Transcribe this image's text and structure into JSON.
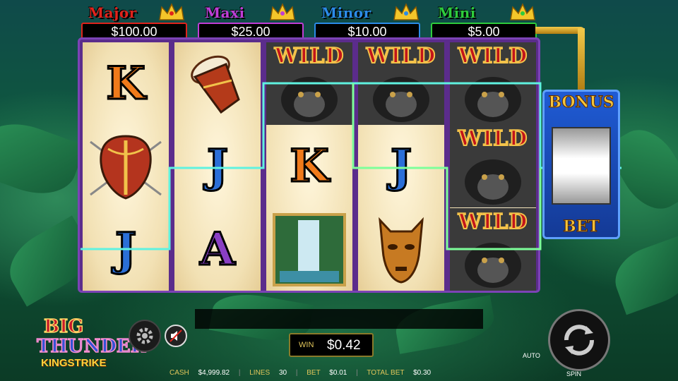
{
  "jackpots": [
    {
      "name": "Major",
      "value": "$100.00",
      "color": "#e0231c"
    },
    {
      "name": "Maxi",
      "value": "$25.00",
      "color": "#c03dd6"
    },
    {
      "name": "Minor",
      "value": "$10.00",
      "color": "#2b8be8"
    },
    {
      "name": "Mini",
      "value": "$5.00",
      "color": "#2ecc3c"
    }
  ],
  "reels": {
    "wild_label": "WILD",
    "symbols": {
      "r1": [
        "K",
        "shield",
        "J"
      ],
      "r2": [
        "drum",
        "J",
        "A"
      ],
      "r3": [
        "WILD",
        "K",
        "waterfall"
      ],
      "r4": [
        "WILD",
        "J",
        "mask"
      ],
      "r5": [
        "WILD",
        "WILD",
        "WILD"
      ]
    }
  },
  "bonus": {
    "title": "BONUS",
    "bet": "BET"
  },
  "logo": {
    "line1": "BIG",
    "line2": "THUNDER",
    "line3": "KINGSTRIKE"
  },
  "win": {
    "label": "WIN",
    "value": "$0.42"
  },
  "controls": {
    "auto_label": "AUTO",
    "spin_label": "SPIN"
  },
  "status": {
    "cash_label": "CASH",
    "cash_value": "$4,999.82",
    "lines_label": "LINES",
    "lines_value": "30",
    "bet_label": "BET",
    "bet_value": "$0.01",
    "total_bet_label": "TOTAL BET",
    "total_bet_value": "$0.30"
  },
  "colors": {
    "payline": "#7dff9a",
    "payline_alt": "#5ff2e0",
    "reel_border": "#7c43b6"
  }
}
